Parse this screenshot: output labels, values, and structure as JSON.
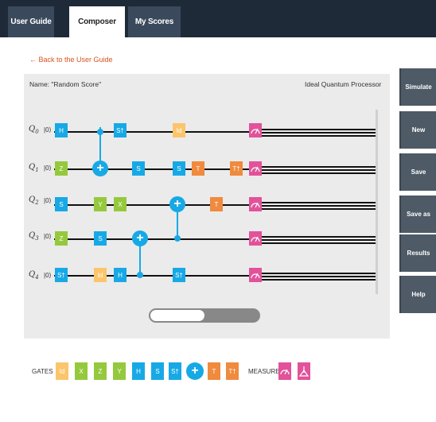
{
  "tabs": [
    {
      "label": "User Guide"
    },
    {
      "label": "Composer"
    },
    {
      "label": "My Scores"
    }
  ],
  "back_link": "← Back to the User Guide",
  "score_name": "Name: \"Random Score\"",
  "processor": "Ideal Quantum Processor",
  "actions": {
    "simulate": "Simulate",
    "new": "New",
    "save": "Save",
    "save_as": "Save as",
    "results": "Results",
    "help": "Help"
  },
  "qubits": [
    {
      "label": "Q",
      "index": "0",
      "ket": "|0⟩"
    },
    {
      "label": "Q",
      "index": "1",
      "ket": "|0⟩"
    },
    {
      "label": "Q",
      "index": "2",
      "ket": "|0⟩"
    },
    {
      "label": "Q",
      "index": "3",
      "ket": "|0⟩"
    },
    {
      "label": "Q",
      "index": "4",
      "ket": "|0⟩"
    }
  ],
  "circuit_gates": {
    "q0_h": "H",
    "q0_sdg": "S†",
    "q0_id": "Id",
    "q1_z": "Z",
    "q1_s_a": "S",
    "q1_s_b": "S",
    "q1_t": "T",
    "q1_tdg": "T†",
    "q2_s": "S",
    "q2_y": "Y",
    "q2_x": "X",
    "q2_t": "T",
    "q3_z": "Z",
    "q3_s": "S",
    "q4_sdg_a": "S†",
    "q4_id": "Id",
    "q4_h": "H",
    "q4_sdg_b": "S†"
  },
  "palette": {
    "gates_label": "GATES",
    "measure_label": "MEASURE",
    "id": "Id",
    "x": "X",
    "z": "Z",
    "y": "Y",
    "h": "H",
    "s": "S",
    "sdg": "S†",
    "t": "T",
    "tdg": "T†"
  },
  "colors": {
    "topbar": "#1e2a38",
    "blue": "#17a9e6",
    "green": "#95c93d",
    "orange": "#f08a3e",
    "yellow": "#fbc56c",
    "pink": "#e2529a",
    "sidebar": "#4e5a66"
  },
  "icons": {
    "measure": "meter-icon",
    "measure_bloch": "bloch-measure-icon",
    "cnot": "plus-icon"
  }
}
